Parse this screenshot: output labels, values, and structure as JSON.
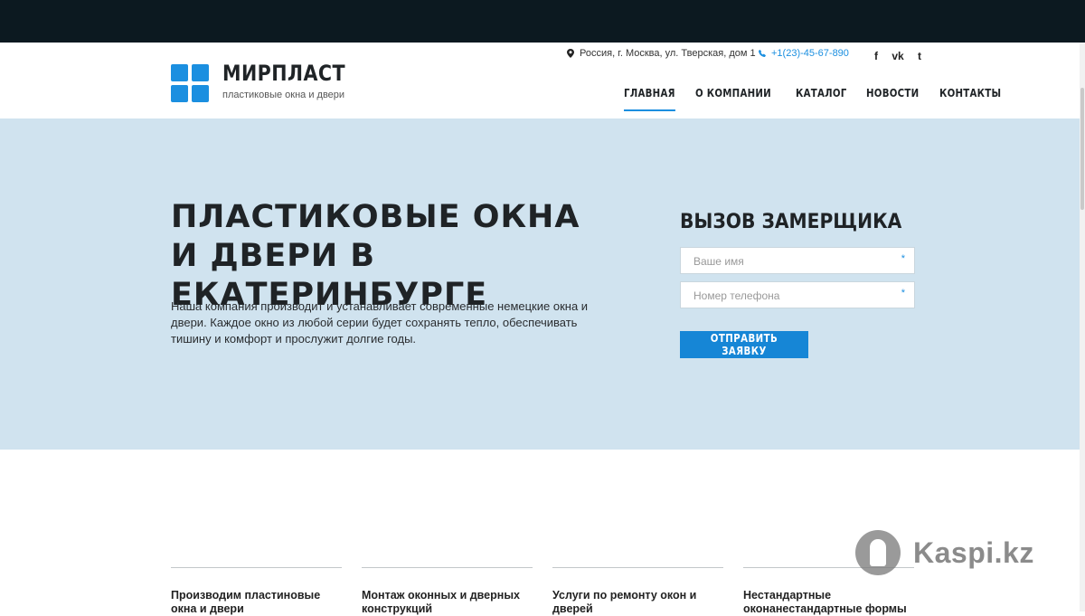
{
  "header": {
    "brand": "МИРПЛАСТ",
    "tagline": "пластиковые окна и двери",
    "address": "Россия, г. Москва, ул. Тверская, дом 1",
    "phone": "+1(23)-45-67-890",
    "socials": [
      "facebook-icon",
      "vk-icon",
      "twitter-icon"
    ],
    "social_glyphs": [
      "f",
      "vk",
      "t"
    ]
  },
  "nav": {
    "items": [
      "ГЛАВНАЯ",
      "О КОМПАНИИ",
      "КАТАЛОГ",
      "НОВОСТИ",
      "КОНТАКТЫ"
    ],
    "active": "ГЛАВНАЯ"
  },
  "hero": {
    "title": "ПЛАСТИКОВЫЕ ОКНА И ДВЕРИ В ЕКАТЕРИНБУРГЕ",
    "text": "Наша компания производит и устанавливает современные немецкие окна и двери. Каждое окно из любой серии будет сохранять тепло, обеспечивать тишину и комфорт и прослужит долгие годы."
  },
  "form": {
    "title": "ВЫЗОВ ЗАМЕРЩИКА",
    "name_placeholder": "Ваше имя",
    "phone_placeholder": "Номер телефона",
    "required_mark": "*",
    "submit_label": "ОТПРАВИТЬ ЗАЯВКУ"
  },
  "services": [
    "Производим пластиновые окна и двери",
    "Монтаж оконных и дверных конструкций",
    "Услуги по ремонту окон и дверей",
    "Нестандартные оконанестандартные формы"
  ],
  "watermark": "Kaspi.kz",
  "colors": {
    "accent": "#1b8fe0",
    "hero_bg": "#d0e3ef",
    "topbar": "#0c1920"
  }
}
